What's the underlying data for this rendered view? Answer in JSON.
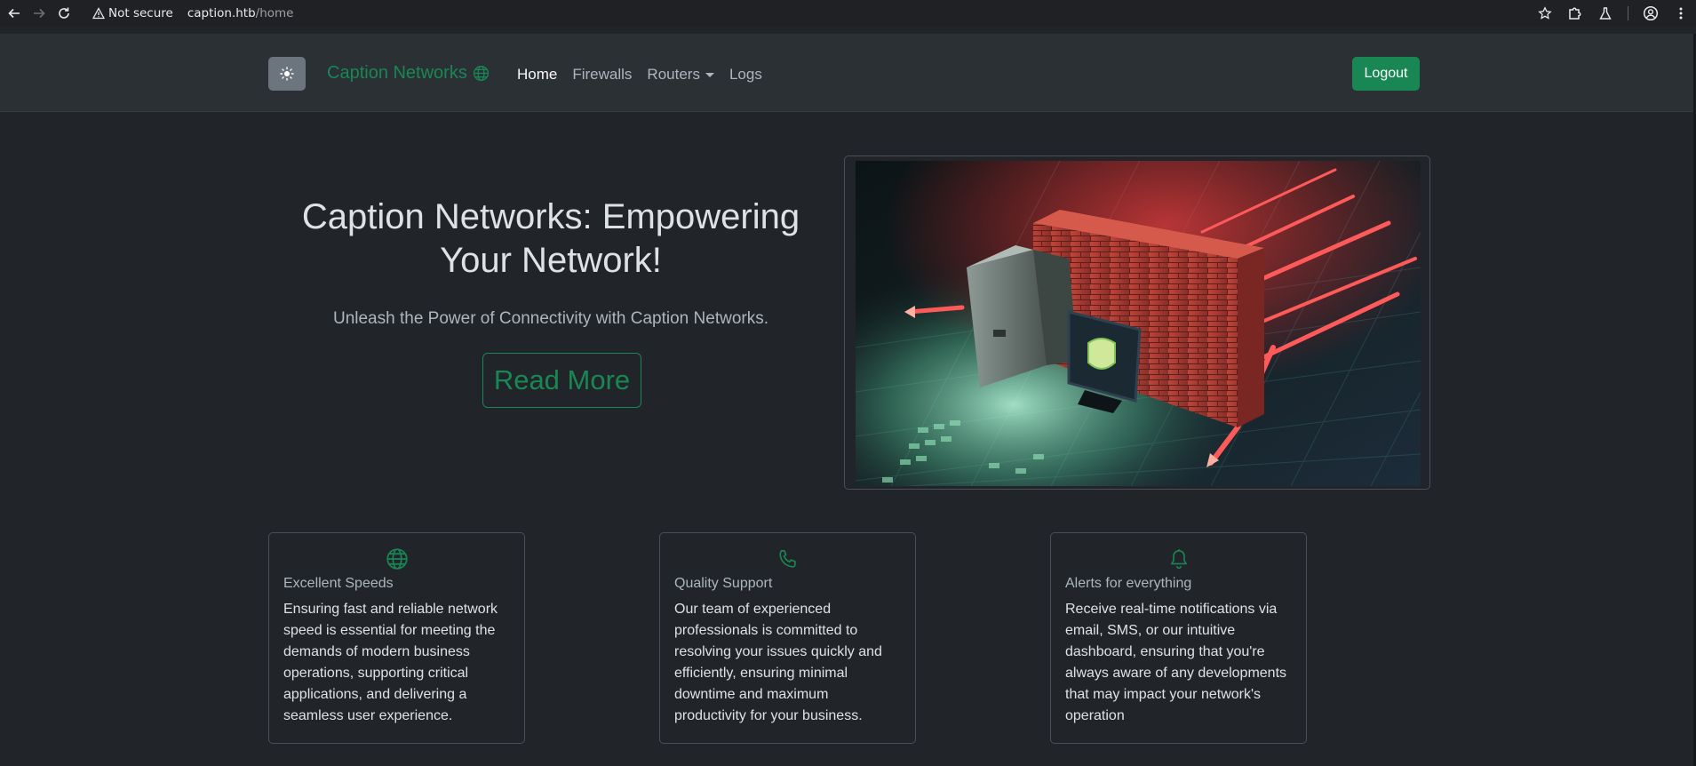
{
  "browser": {
    "security_label": "Not secure",
    "url_host": "caption.htb",
    "url_path": "/home"
  },
  "navbar": {
    "theme_toggle_icon": "sun-icon",
    "brand": "Caption Networks",
    "links": [
      {
        "label": "Home",
        "active": true
      },
      {
        "label": "Firewalls",
        "active": false
      },
      {
        "label": "Routers",
        "active": false,
        "dropdown": true
      },
      {
        "label": "Logs",
        "active": false
      }
    ],
    "logout": "Logout"
  },
  "hero": {
    "title": "Caption Networks: Empowering Your Network!",
    "lead": "Unleash the Power of Connectivity with Caption Networks.",
    "button": "Read More",
    "image": "firewall-illustration"
  },
  "features": [
    {
      "icon": "globe-icon",
      "title": "Excellent Speeds",
      "text": "Ensuring fast and reliable network speed is essential for meeting the demands of modern business operations, supporting critical applications, and delivering a seamless user experience."
    },
    {
      "icon": "phone-icon",
      "title": "Quality Support",
      "text": "Our team of experienced professionals is committed to resolving your issues quickly and efficiently, ensuring minimal downtime and maximum productivity for your business."
    },
    {
      "icon": "bell-icon",
      "title": "Alerts for everything",
      "text": "Receive real-time notifications via email, SMS, or our intuitive dashboard, ensuring that you're always aware of any developments that may impact your network's operation"
    }
  ],
  "colors": {
    "accent": "#198754",
    "background": "#212529",
    "navbar": "#2b3035"
  }
}
